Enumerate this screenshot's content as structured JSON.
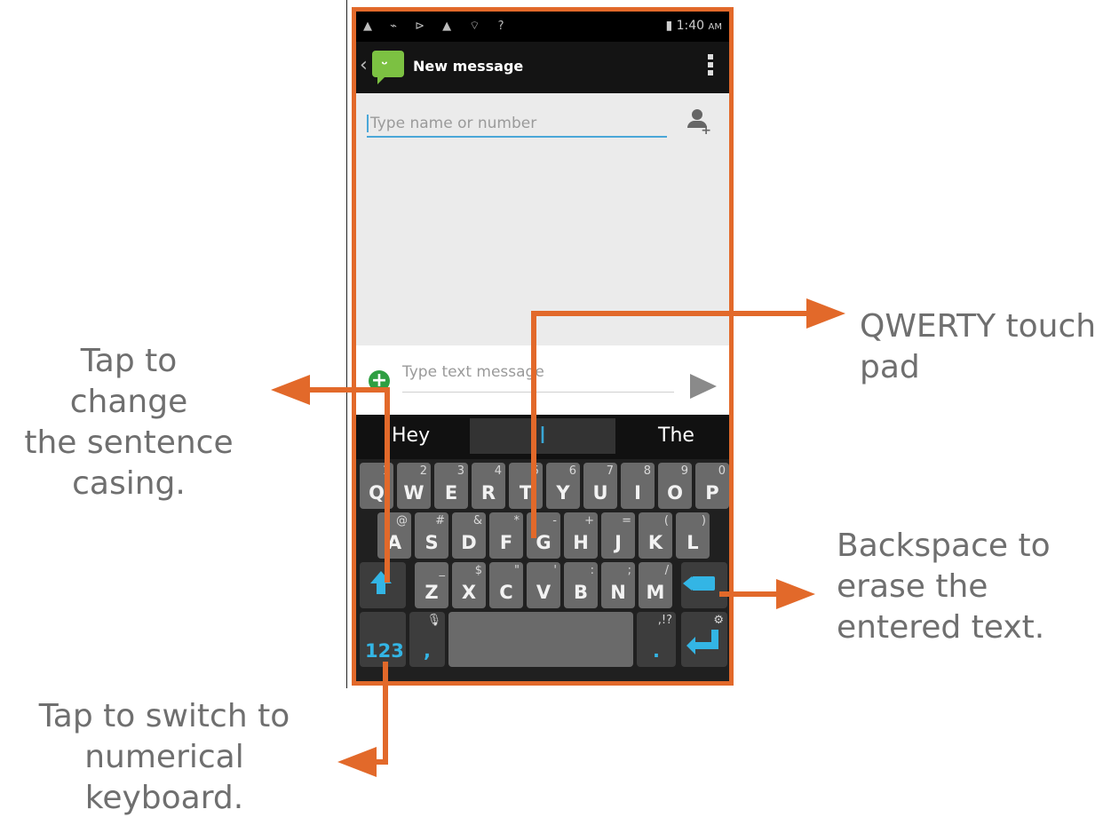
{
  "annotations": {
    "sentence_casing": [
      "Tap to change",
      "the sentence",
      "casing."
    ],
    "qwerty": [
      "QWERTY touch",
      "pad"
    ],
    "backspace": [
      "Backspace to",
      "erase the",
      "entered text."
    ],
    "numeric": [
      "Tap to switch to",
      "numerical",
      "keyboard."
    ]
  },
  "status_bar": {
    "icons_left": "▲ ⌁ ⊳ ▲ ⌔ ?",
    "time": "1:40",
    "ampm": "AM"
  },
  "action_bar": {
    "back_icon": "chevron-left-icon",
    "app_icon": "messaging-icon",
    "title": "New message",
    "overflow_icon": "overflow-menu-icon"
  },
  "recipient": {
    "placeholder": "Type name or number",
    "add_contact_icon": "add-contact-icon"
  },
  "composer": {
    "attach_icon": "plus-circle-icon",
    "placeholder": "Type text message",
    "send_icon": "send-icon"
  },
  "keyboard": {
    "suggestions": [
      "Hey",
      "I",
      "The"
    ],
    "row1": [
      {
        "main": "Q",
        "sub": "1"
      },
      {
        "main": "W",
        "sub": "2"
      },
      {
        "main": "E",
        "sub": "3"
      },
      {
        "main": "R",
        "sub": "4"
      },
      {
        "main": "T",
        "sub": "5"
      },
      {
        "main": "Y",
        "sub": "6"
      },
      {
        "main": "U",
        "sub": "7"
      },
      {
        "main": "I",
        "sub": "8"
      },
      {
        "main": "O",
        "sub": "9"
      },
      {
        "main": "P",
        "sub": "0"
      }
    ],
    "row2": [
      {
        "main": "A",
        "sub": "@"
      },
      {
        "main": "S",
        "sub": "#"
      },
      {
        "main": "D",
        "sub": "&"
      },
      {
        "main": "F",
        "sub": "*"
      },
      {
        "main": "G",
        "sub": "-"
      },
      {
        "main": "H",
        "sub": "+"
      },
      {
        "main": "J",
        "sub": "="
      },
      {
        "main": "K",
        "sub": "("
      },
      {
        "main": "L",
        "sub": ")"
      }
    ],
    "row3": [
      {
        "main": "Z",
        "sub": "_"
      },
      {
        "main": "X",
        "sub": "$"
      },
      {
        "main": "C",
        "sub": "\""
      },
      {
        "main": "V",
        "sub": "'"
      },
      {
        "main": "B",
        "sub": ":"
      },
      {
        "main": "N",
        "sub": ";"
      },
      {
        "main": "M",
        "sub": "/"
      }
    ],
    "numbers_key": "123",
    "comma_key": ",",
    "mic_icon": "microphone-icon",
    "period_key": ".",
    "period_sub": ",!?",
    "shift_icon": "shift-icon",
    "backspace_icon": "backspace-icon",
    "enter_icon": "enter-icon",
    "settings_icon": "settings-icon",
    "accent": "#33b5e5"
  },
  "colors": {
    "frame": "#e2692a",
    "annotation_text": "#6f6f6f"
  }
}
